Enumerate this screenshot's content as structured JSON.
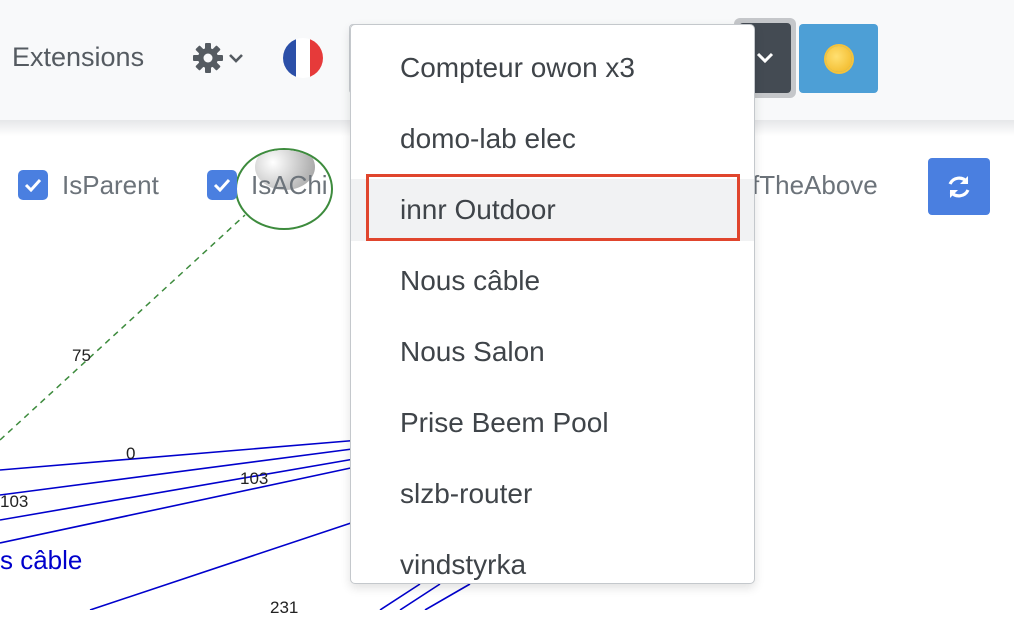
{
  "nav": {
    "extensions_label": "Extensions"
  },
  "filters": [
    {
      "label": "IsParent",
      "checked": true
    },
    {
      "label": "IsAChild",
      "checked": true
    },
    {
      "label": "NoneOfTheAbove",
      "checked": true
    }
  ],
  "visible_filter_text": {
    "first": "IsParent",
    "second_partial": "IsAChi",
    "third_partial": "fTheAbove"
  },
  "graph": {
    "edge_labels": [
      "75",
      "0",
      "103",
      "103",
      "231"
    ],
    "node_labels": [
      "s câble"
    ]
  },
  "dropdown": {
    "items": [
      "Compteur owon x3",
      "domo-lab elec",
      "innr Outdoor",
      "Nous câble",
      "Nous Salon",
      "Prise Beem Pool",
      "slzb-router",
      "vindstyrka"
    ],
    "highlighted_item": "innr Outdoor"
  },
  "colors": {
    "accent": "#4a7fe0",
    "theme_button": "#4d9fd6",
    "highlight": "#e0452d",
    "edge_blue": "#0000cc",
    "edge_green": "#3d8b3d"
  }
}
